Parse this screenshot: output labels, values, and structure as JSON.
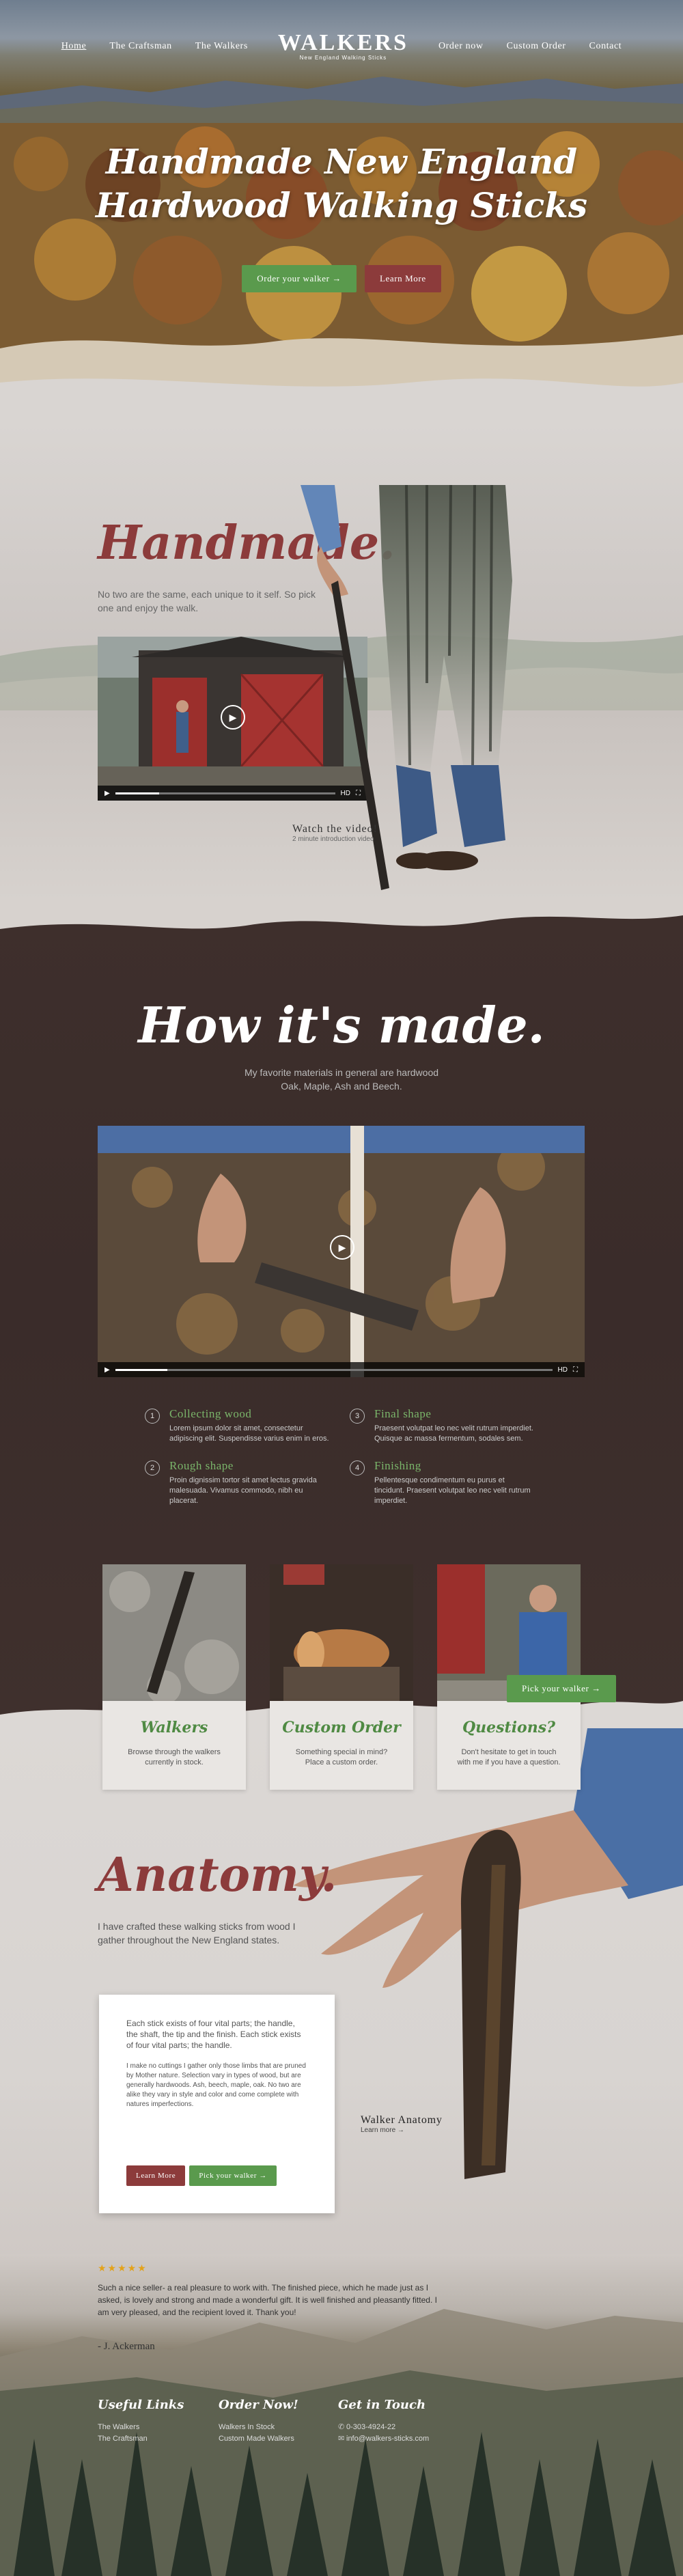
{
  "nav": {
    "left": [
      "Home",
      "The Craftsman",
      "The Walkers"
    ],
    "right": [
      "Order now",
      "Custom Order",
      "Contact"
    ],
    "logo_word": "WALKERS",
    "logo_tag": "New England Walking Sticks"
  },
  "hero": {
    "title_line1": "Handmade New England",
    "title_line2": "Hardwood Walking Sticks",
    "order_button": "Order your walker →",
    "learn_button": "Learn More"
  },
  "handmade": {
    "title": "Handmade.",
    "text": "No two are the same, each unique to it self. So pick one and enjoy the walk.",
    "watch_title": "Watch the video!",
    "watch_sub": "2 minute introduction video",
    "video_hd": "HD"
  },
  "how": {
    "title": "How it's made.",
    "text_line1": "My favorite materials in general are hardwood",
    "text_line2": "Oak, Maple, Ash and Beech.",
    "video_hd": "HD",
    "steps": [
      {
        "num": "1",
        "title": "Collecting wood",
        "desc": "Lorem ipsum dolor sit amet, consectetur adipiscing elit. Suspendisse varius enim in eros."
      },
      {
        "num": "3",
        "title": "Final shape",
        "desc": "Praesent volutpat leo nec velit rutrum imperdiet. Quisque ac massa fermentum, sodales sem."
      },
      {
        "num": "2",
        "title": "Rough shape",
        "desc": "Proin dignissim tortor sit amet lectus gravida malesuada. Vivamus commodo, nibh eu placerat."
      },
      {
        "num": "4",
        "title": "Finishing",
        "desc": "Pellentesque condimentum eu purus et tincidunt. Praesent volutpat leo nec velit rutrum imperdiet."
      }
    ]
  },
  "cards": {
    "pick_button": "Pick your walker →",
    "items": [
      {
        "title": "Walkers",
        "desc": "Browse through the walkers currently in stock."
      },
      {
        "title": "Custom Order",
        "desc": "Something special in mind? Place a custom order."
      },
      {
        "title": "Questions?",
        "desc": "Don't hesitate to get in touch with me if you have a question."
      }
    ]
  },
  "anatomy": {
    "title": "Anatomy.",
    "text": "I have crafted these walking sticks from wood I gather throughout the New England states.",
    "card_text1": "Each stick exists of four vital parts; the handle, the shaft, the tip and the finish. Each stick exists of four vital parts; the handle.",
    "card_text2": "I make no cuttings I gather only those limbs that are pruned by Mother nature. Selection vary in types of wood, but are generally hardwoods. Ash, beech, maple, oak. No two are alike they vary in style and color and come complete with natures imperfections.",
    "learn_button": "Learn More",
    "pick_button": "Pick your walker →",
    "label_title": "Walker Anatomy",
    "label_sub": "Learn more →"
  },
  "testimonial": {
    "stars": "★★★★★",
    "quote": "Such a nice seller- a real pleasure to work with. The finished piece, which he made just as I asked, is lovely and strong and made a wonderful gift. It is well finished and pleasantly fitted. I am very pleased, and the recipient loved it. Thank you!",
    "author": "- J. Ackerman"
  },
  "footer": {
    "col1_title": "Useful Links",
    "col1_links": [
      "The Walkers",
      "The Craftsman"
    ],
    "col2_title": "Order Now!",
    "col2_links": [
      "Walkers In Stock",
      "Custom Made Walkers"
    ],
    "col3_title": "Get in Touch",
    "phone": "0-303-4924-22",
    "email": "info@walkers-sticks.com"
  },
  "colors": {
    "accent_green": "#5a9a4d",
    "accent_red": "#8c3b3b",
    "dark_brown": "#3a2e2c",
    "star": "#e3a21a"
  },
  "icons": [
    "play-icon",
    "phone-icon",
    "mail-icon",
    "fullscreen-icon",
    "arrow-right-icon"
  ]
}
